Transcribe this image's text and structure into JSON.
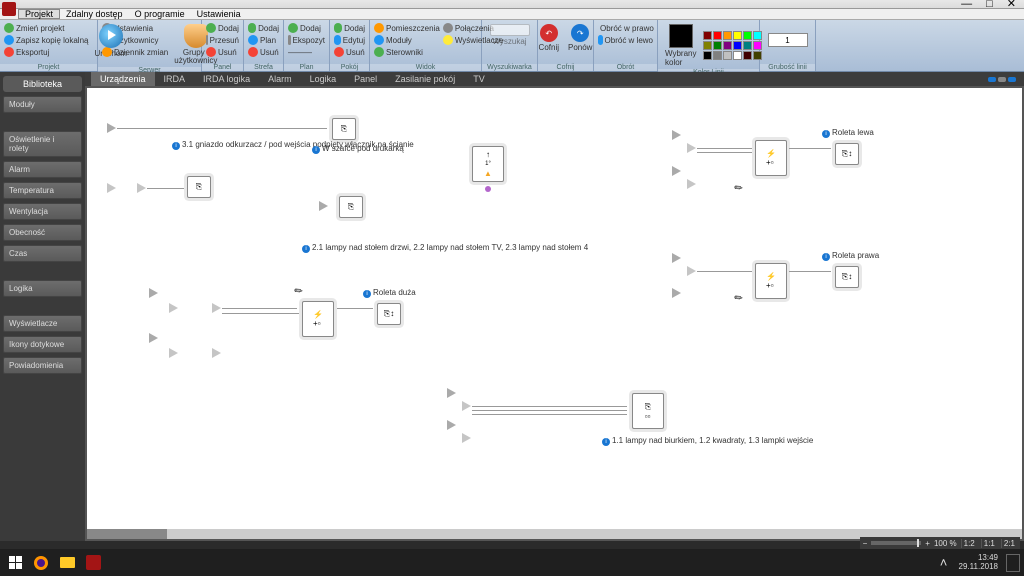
{
  "window": {
    "min": "—",
    "max": "□",
    "close": "✕"
  },
  "menu": [
    "Projekt",
    "Zdalny dostęp",
    "O programie",
    "Ustawienia"
  ],
  "ribbon": {
    "projekt": {
      "label": "Projekt",
      "items": [
        "Zmień projekt",
        "Zapisz kopię lokalną",
        "Eksportuj"
      ],
      "run": "Uruchom"
    },
    "serwer": {
      "label": "Serwer",
      "items": [
        "Ustawienia",
        "Użytkownicy",
        "Dziennik zmian"
      ],
      "big": "Grupy i użytkownicy"
    },
    "panel": {
      "label": "Panel",
      "add": "Dodaj",
      "move": "Przesuń",
      "del": "Usuń"
    },
    "strefa": {
      "label": "Strefa",
      "add": "Dodaj",
      "plan": "Plan",
      "del": "Usuń"
    },
    "plan": {
      "label": "Plan",
      "add": "Dodaj",
      "disp": "Ekspozyt",
      "line": "———"
    },
    "pokoj": {
      "label": "Pokój",
      "add": "Dodaj",
      "edit": "Edytuj",
      "del": "Usuń"
    },
    "widok": {
      "label": "Widok",
      "rooms": "Pomieszczenia",
      "mods": "Moduły",
      "ctrl": "Sterowniki",
      "conn": "Połączenia",
      "disp": "Wyświetlacze"
    },
    "search": {
      "label": "Wyszukiwarka",
      "btn": "Wyszukaj"
    },
    "undo": {
      "label": "Cofnij",
      "undo": "Cofnij",
      "redo": "Ponów"
    },
    "rotate": {
      "label": "Obrót",
      "r": "Obróć w prawo",
      "l": "Obróć w lewo"
    },
    "color": {
      "label": "Kolor Linii",
      "sel": "Wybrany kolor"
    },
    "lw": {
      "label": "Grubość linii",
      "val": "1"
    }
  },
  "sidebar": {
    "header": "Biblioteka",
    "items": [
      "Moduły",
      "Oświetlenie i rolety",
      "Alarm",
      "Temperatura",
      "Wentylacja",
      "Obecność",
      "Czas",
      "Logika",
      "Wyświetlacze",
      "Ikony dotykowe",
      "Powiadomienia"
    ]
  },
  "tabs": [
    "Urządzenia",
    "IRDA",
    "IRDA logika",
    "Alarm",
    "Logika",
    "Panel",
    "Zasilanie pokój",
    "TV"
  ],
  "canvas": {
    "l1": "3.1 gniazdo odkurzacz / pod wejścia podpięty włącznik na ścianie",
    "l2": "W szafce pod drukarką",
    "l3": "2.1 lampy nad stołem drzwi, 2.2 lampy nad stołem TV, 2.3 lampy nad stołem 4",
    "l4": "Roleta duża",
    "l5": "Roleta lewa",
    "l6": "Roleta prawa",
    "l7": "1.1 lampy nad biurkiem, 1.2 kwadraty, 1.3 lampki wejście"
  },
  "zoom": {
    "pct": "100 %",
    "r1": "1:2",
    "r2": "1:1",
    "r3": "2:1"
  },
  "clock": {
    "time": "13:49",
    "date": "29.11.2018"
  },
  "palette": [
    "#800000",
    "#ff0000",
    "#ff9800",
    "#ffff00",
    "#00ff00",
    "#00ffff",
    "#808000",
    "#008000",
    "#800080",
    "#0000ff",
    "#008080",
    "#ff00ff",
    "#000000",
    "#808080",
    "#c0c0c0",
    "#ffffff",
    "#400000",
    "#404000"
  ]
}
